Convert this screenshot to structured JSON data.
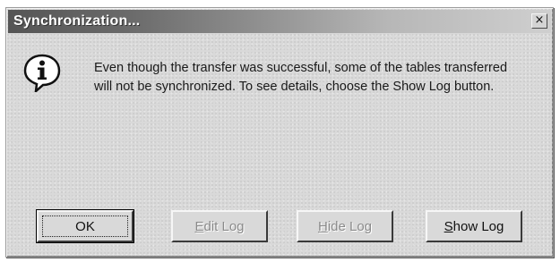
{
  "dialog": {
    "title": "Synchronization...",
    "close_label": "×",
    "icon": "information-icon",
    "message": "Even though the transfer was successful, some of the tables transferred will not be synchronized.  To see details, choose the Show Log button."
  },
  "buttons": {
    "ok": {
      "label": "OK",
      "mnemonic": "",
      "rest": "OK",
      "enabled": true,
      "default": true
    },
    "edit_log": {
      "label": "Edit Log",
      "mnemonic": "E",
      "rest": "dit Log",
      "enabled": false
    },
    "hide_log": {
      "label": "Hide Log",
      "mnemonic": "H",
      "rest": "ide Log",
      "enabled": false
    },
    "show_log": {
      "label": "Show Log",
      "mnemonic": "S",
      "rest": "how Log",
      "enabled": true
    }
  }
}
